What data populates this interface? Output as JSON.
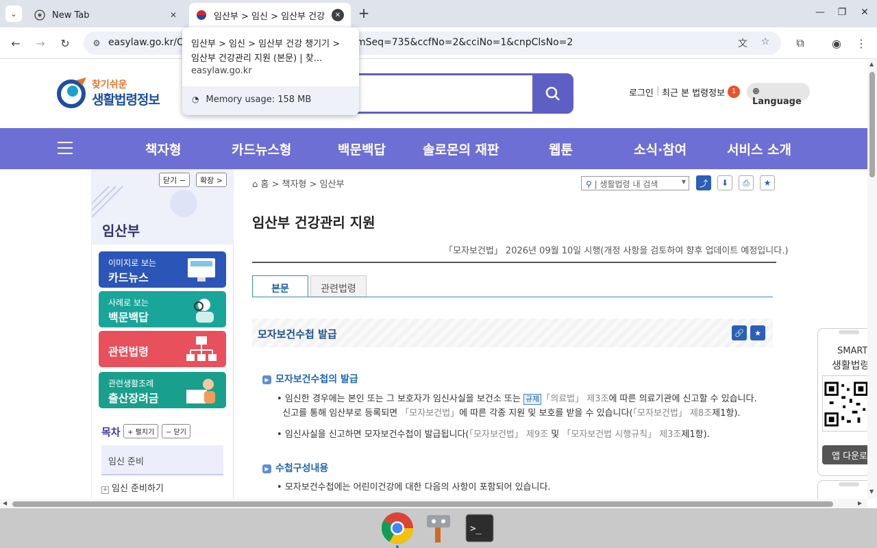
{
  "browser": {
    "tabs": [
      {
        "title": "New Tab",
        "active": false
      },
      {
        "title": "임산부 > 임신 > 임산부 건강",
        "active": true
      }
    ],
    "url_prefix": "easylaw.go.kr/C",
    "url_suffix": "mSeq=735&ccfNo=2&cciNo=1&cnpClsNo=2",
    "hover_card": {
      "title": "임산부 > 임신 > 임산부 건강 챙기기 > 임산부 건강관리 지원 (본문) | 찾...",
      "domain": "easylaw.go.kr",
      "memory": "Memory usage: 158 MB"
    }
  },
  "site": {
    "logo_sub": "찾기쉬운",
    "logo_main": "생활법령정보",
    "login": "로그인",
    "recent": "최근 본 법령정보",
    "recent_count": "1",
    "language": "Language"
  },
  "nav": [
    "책자형",
    "카드뉴스형",
    "백문백답",
    "솔로몬의 재판",
    "웹툰",
    "소식·참여",
    "서비스 소개"
  ],
  "sidebar": {
    "close_btn": "닫기 −",
    "expand_btn": "확장 >",
    "title": "임산부",
    "cards": [
      {
        "small": "이미지로 보는",
        "big": "카드뉴스",
        "color": "#2b56b8"
      },
      {
        "small": "사례로 보는",
        "big": "백문백답",
        "color": "#1aa59a"
      },
      {
        "small": "",
        "big": "관련법령",
        "color": "#e8505b"
      },
      {
        "small": "관련생활조례",
        "big": "출산장려금",
        "color": "#18a08c"
      }
    ],
    "toc_label": "목차",
    "toc_expand": "+ 펼치기",
    "toc_collapse": "− 닫기",
    "toc_items": [
      "임신 준비",
      "임신 준비하기"
    ]
  },
  "content": {
    "breadcrumb": "홈 > 책자형 > 임산부",
    "search_placeholder": "| 생활법령 내 검색",
    "title": "임산부 건강관리 지원",
    "law_note": "「모자보건법」 2026년 09월 10일 시행(개정 사항을 검토하여 향후 업데이트 예정입니다.)",
    "tabs": [
      "본문",
      "관련법령"
    ],
    "section_title": "모자보건수첩 발급",
    "sub1": "모자보건수첩의 발급",
    "p1a_1": "임신한 경우에는 본인 또는 그 보호자가 임신사실을 보건소 또는",
    "p1a_rule": "규제",
    "p1a_law": "「의료법」 제3조",
    "p1a_2": "에 따른 의료기관에 신고할 수 있습니다.",
    "p1b_1": "신고를 통해 임산부로 등록되면",
    "p1b_law": "「모자보건법」",
    "p1b_2": "에 따른 각종 지원 및 보호를 받을 수 있습니다(",
    "p1b_law2": "「모자보건법」 제8조",
    "p1b_3": "제1항).",
    "p2_1": "임신사실을 신고하면 모자보건수첩이 발급됩니다(",
    "p2_law": "「모자보건법」 제9조",
    "p2_2": " 및 ",
    "p2_law2": "「모자보건법 시행규칙」 제3조",
    "p2_3": "제1항).",
    "sub2": "수첩구성내용",
    "p3": "모자보건수첩에는 어린이건강에 대한 다음의 사항이 포함되어 있습니다."
  },
  "side_panel": {
    "line1": "SMART",
    "line2": "생활법령",
    "app_btn": "앱 다운로드"
  },
  "colors": {
    "nav_bg": "#6e6fd4",
    "search_accent": "#5e5fc5",
    "link_blue": "#1d66b8"
  }
}
